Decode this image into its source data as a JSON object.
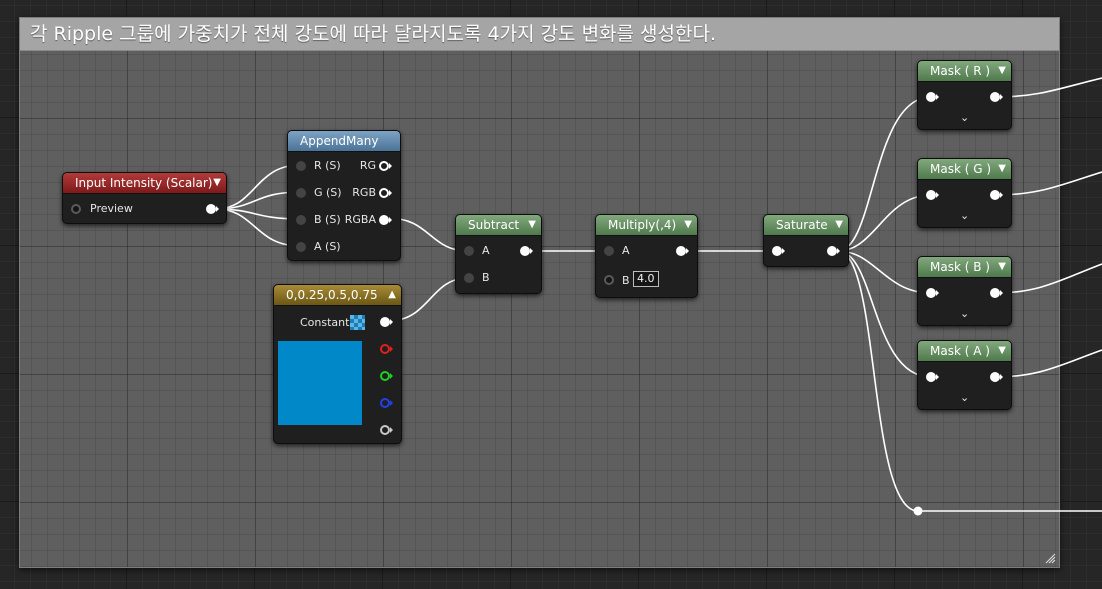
{
  "comment": {
    "text": "각 Ripple 그룹에 가중치가 전체 강도에 따라 달라지도록 4가지 강도 변화를 생성한다."
  },
  "nodes": {
    "input_intensity": {
      "title": "Input Intensity (Scalar)",
      "output_label": "Preview"
    },
    "append_many": {
      "title": "AppendMany",
      "inputs": [
        "R (S)",
        "G (S)",
        "B (S)",
        "A (S)"
      ],
      "outputs": [
        "RG",
        "RGB",
        "RGBA"
      ]
    },
    "constant": {
      "title": "0,0.25,0.5,0.75",
      "output_label": "Constant",
      "color": "#0088c8"
    },
    "subtract": {
      "title": "Subtract",
      "inputs": [
        "A",
        "B"
      ]
    },
    "multiply": {
      "title": "Multiply(,4)",
      "inputs": [
        "A",
        "B"
      ],
      "b_value": "4.0"
    },
    "saturate": {
      "title": "Saturate"
    },
    "masks": [
      {
        "title": "Mask ( R )"
      },
      {
        "title": "Mask ( G )"
      },
      {
        "title": "Mask ( B )"
      },
      {
        "title": "Mask ( A )"
      }
    ]
  },
  "colors": {
    "comment_bg": "#5f5f5f",
    "comment_header": "#a5a5a5",
    "graph_bg": "#262626",
    "math_header": "#4f7a4c",
    "append_header": "#4a7398",
    "param_header": "#7e1a1a",
    "constant_header": "#6b5715",
    "wire": "#ffffff"
  },
  "icons": {
    "dropdown": "chevron-down-icon",
    "collapse": "chevron-up-icon",
    "expand": "chevron-down-icon",
    "resize": "resize-grip-icon",
    "checker": "checker-icon"
  }
}
